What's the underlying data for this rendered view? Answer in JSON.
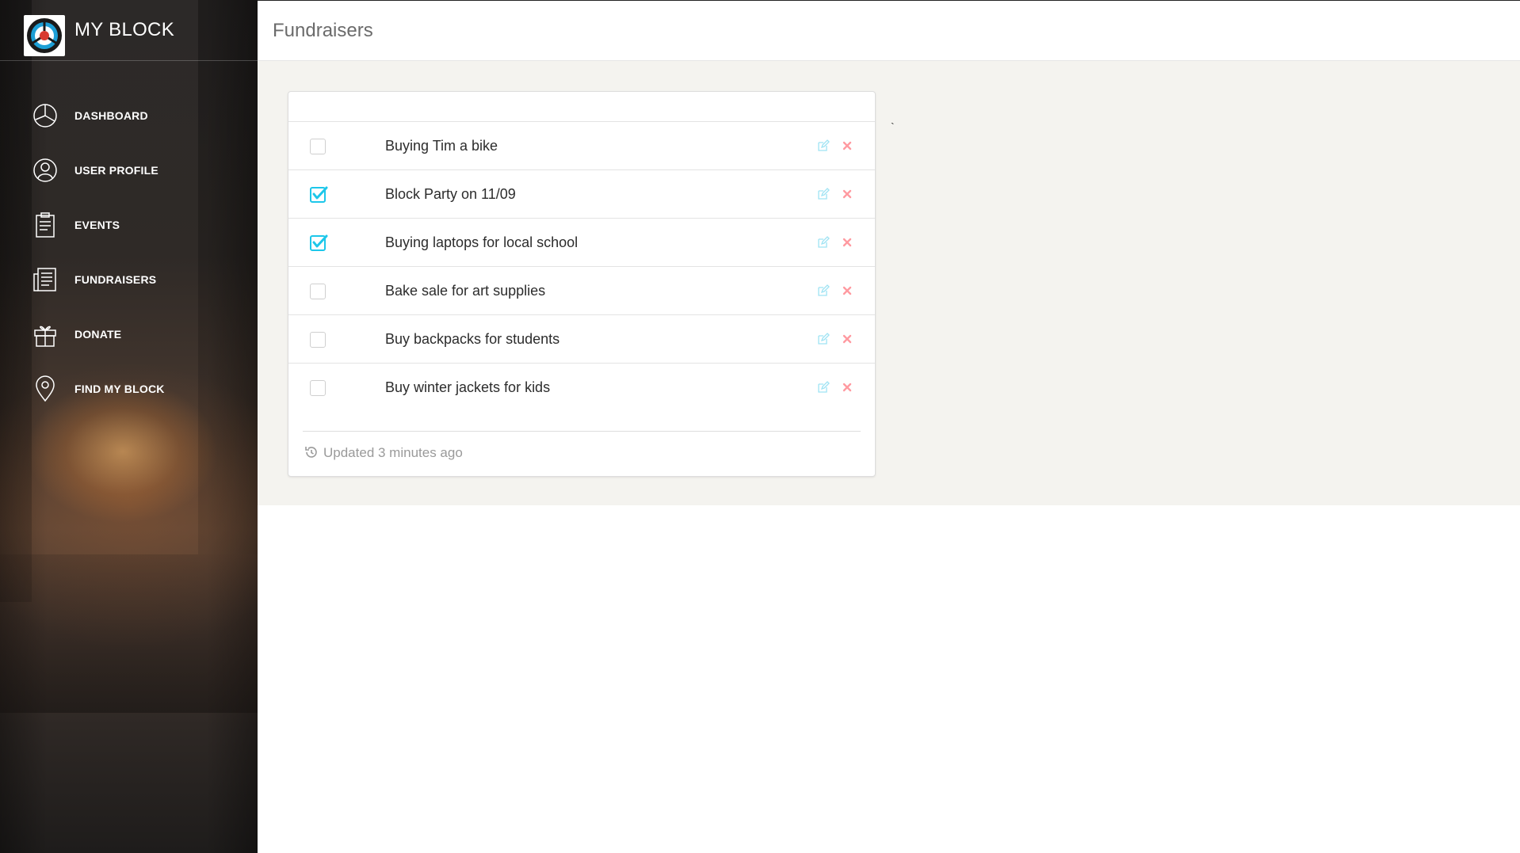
{
  "brand": {
    "title": "MY BLOCK",
    "logo_icon": "my-block-logo"
  },
  "sidebar": {
    "items": [
      {
        "label": "DASHBOARD",
        "icon": "pie-chart-icon"
      },
      {
        "label": "USER PROFILE",
        "icon": "user-icon"
      },
      {
        "label": "EVENTS",
        "icon": "clipboard-icon"
      },
      {
        "label": "FUNDRAISERS",
        "icon": "newspaper-icon"
      },
      {
        "label": "DONATE",
        "icon": "gift-icon"
      },
      {
        "label": "FIND MY BLOCK",
        "icon": "map-pin-icon"
      }
    ]
  },
  "header": {
    "title": "Fundraisers"
  },
  "stray_char": "`",
  "fundraisers": {
    "items": [
      {
        "text": "Buying Tim a bike",
        "checked": false
      },
      {
        "text": "Block Party on 11/09",
        "checked": true
      },
      {
        "text": "Buying laptops for local school",
        "checked": true
      },
      {
        "text": "Bake sale for art supplies",
        "checked": false
      },
      {
        "text": "Buy backpacks for students",
        "checked": false
      },
      {
        "text": "Buy winter jackets for kids",
        "checked": false
      }
    ],
    "footer": "Updated 3 minutes ago"
  },
  "colors": {
    "accent": "#1dc7ea",
    "danger": "#ff4a55",
    "sidebar_text": "#ffffff",
    "content_bg": "#f4f3ef"
  }
}
